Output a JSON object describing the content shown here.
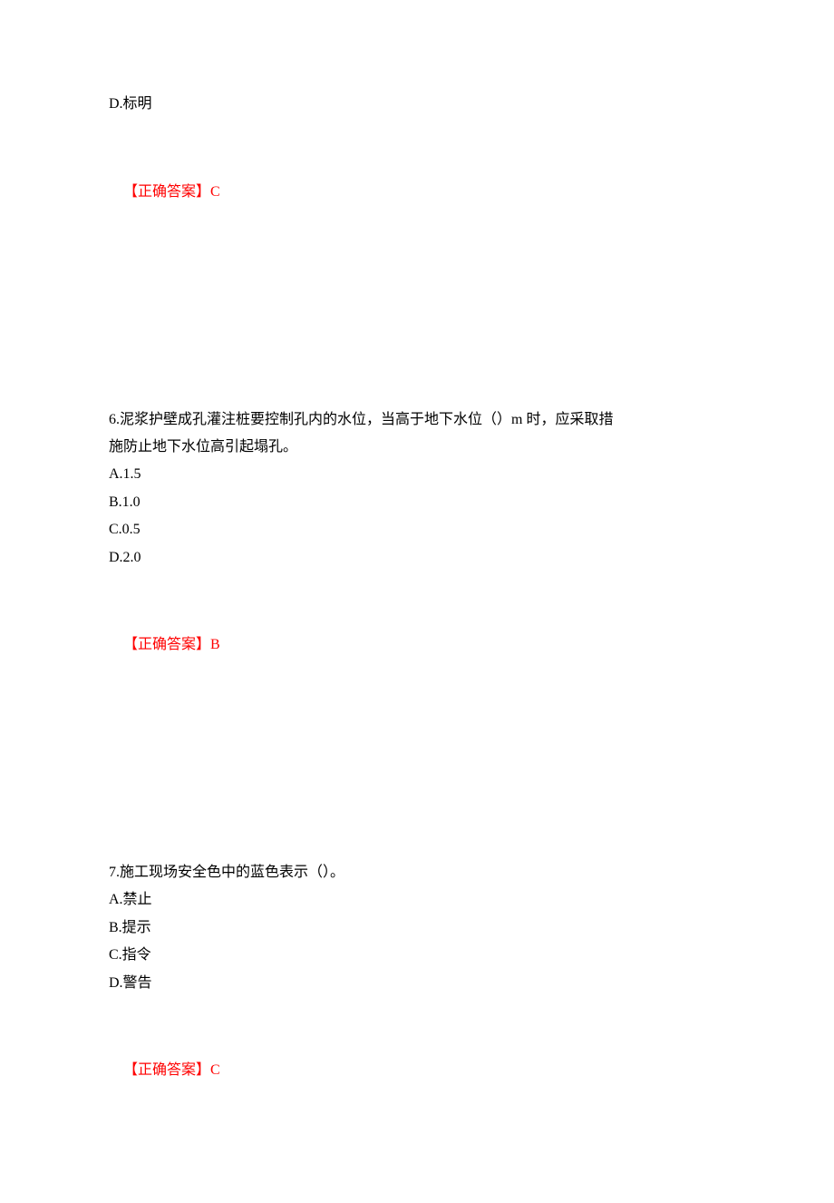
{
  "prev_question": {
    "option_d": "D.标明",
    "answer_label": "【正确答案】",
    "answer_value": "C"
  },
  "q6": {
    "stem_part1": "6.泥浆护壁成孔灌注桩要控制孔内的水位，当高于地下水位（）m 时，应采取措",
    "stem_part2": "施防止地下水位高引起塌孔。",
    "option_a": "A.1.5",
    "option_b": "B.1.0",
    "option_c": "C.0.5",
    "option_d": "D.2.0",
    "answer_label": "【正确答案】",
    "answer_value": "B"
  },
  "q7": {
    "stem": "7.施工现场安全色中的蓝色表示（）。",
    "option_a": "A.禁止",
    "option_b": "B.提示",
    "option_c": "C.指令",
    "option_d": "D.警告",
    "answer_label": "【正确答案】",
    "answer_value": "C"
  }
}
